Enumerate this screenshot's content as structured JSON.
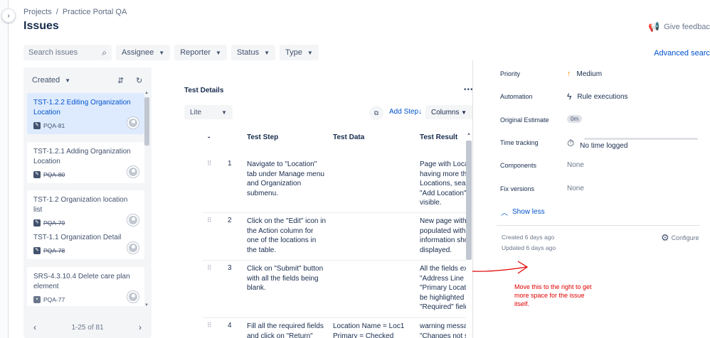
{
  "breadcrumb": {
    "project_root": "Projects",
    "separator": "/",
    "project": "Practice Portal QA"
  },
  "page": {
    "title": "Issues"
  },
  "header": {
    "feedback": "Give feedbac",
    "advanced_search": "Advanced searc"
  },
  "filters": {
    "search_placeholder": "Search issues",
    "assignee": "Assignee",
    "reporter": "Reporter",
    "status": "Status",
    "type": "Type"
  },
  "issue_list": {
    "sort_label": "Created",
    "items": [
      {
        "title": "TST-1.2.2 Editing Organization Location",
        "key": "PQA-81",
        "selected": true,
        "strike": false
      },
      {
        "title": "TST-1.2.1 Adding Organization Location",
        "key": "PQA-80",
        "selected": false,
        "strike": true
      },
      {
        "title": "TST-1.2 Organization location list",
        "key": "PQA-79",
        "selected": false,
        "strike": true
      },
      {
        "title": "TST-1.1 Organization Detail",
        "key": "PQA-78",
        "selected": false,
        "strike": true
      },
      {
        "title": "SRS-4.3.10.4 Delete care plan element",
        "key": "PQA-77",
        "selected": false,
        "strike": false
      }
    ],
    "pagination": "1-25 of 81"
  },
  "test_details": {
    "title": "Test Details",
    "view_mode": "Lite",
    "add_step": "Add Step",
    "columns_label": "Columns",
    "headers": {
      "num": "-",
      "step": "Test Step",
      "data": "Test Data",
      "result": "Test Result"
    },
    "rows": [
      {
        "num": "1",
        "step": "Navigate to \"Location\" tab under Manage menu and Organization submenu.",
        "data": "",
        "result": "Page with Loca\nhaving more tha\nLocations, sear\n\"Add Location\"\nvisible."
      },
      {
        "num": "2",
        "step": "Click on the \"Edit\" icon in the Action column for one of the locations in the table.",
        "data": "",
        "result": "New page with\npopulated with\ninformation sho\ndisplayed."
      },
      {
        "num": "3",
        "step": "Click on \"Submit\" button with all the fields being blank.",
        "data": "",
        "result": "All the fields ex\n\"Address Line 2\n\"Primary Locati\nbe highlighted a\n\"Required\" field"
      },
      {
        "num": "4",
        "step": "Fill all the required fields and click on \"Return\"",
        "data": "Location Name = Loc1\nPrimary = Checked",
        "result": "warning messa\n\"Changes not s"
      }
    ]
  },
  "details": {
    "priority_label": "Priority",
    "priority_value": "Medium",
    "automation_label": "Automation",
    "automation_value": "Rule executions",
    "estimate_label": "Original Estimate",
    "estimate_value": "0m",
    "time_label": "Time tracking",
    "time_value": "No time logged",
    "components_label": "Components",
    "components_value": "None",
    "fixversions_label": "Fix versions",
    "fixversions_value": "None",
    "show_less": "Show less",
    "created": "Created 6 days ago",
    "updated": "Updated 6 days ago",
    "configure": "Configure"
  },
  "annotation": {
    "text": "Move this to the right to get more space for the issue itself.",
    "color": "#e00000"
  }
}
